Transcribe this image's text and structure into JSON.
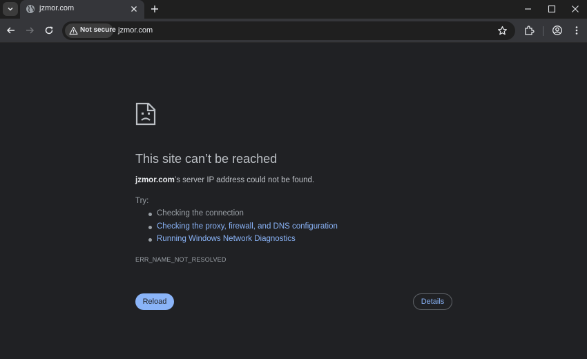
{
  "tab": {
    "title": "jzmor.com",
    "favicon": "globe-icon"
  },
  "toolbar": {
    "security_chip": "Not secure",
    "url": "jzmor.com"
  },
  "error": {
    "heading": "This site can’t be reached",
    "host": "jzmor.com",
    "description_rest": "’s server IP address could not be found.",
    "try_label": "Try:",
    "suggestions": [
      {
        "text": "Checking the connection",
        "link": false
      },
      {
        "text": "Checking the proxy, firewall, and DNS configuration",
        "link": true
      },
      {
        "text": "Running Windows Network Diagnostics",
        "link": true
      }
    ],
    "code": "ERR_NAME_NOT_RESOLVED"
  },
  "buttons": {
    "reload": "Reload",
    "details": "Details"
  },
  "colors": {
    "background": "#202124",
    "link": "#8ab4f8",
    "primary_button": "#8ab4f8",
    "text": "#bdc1c6"
  }
}
